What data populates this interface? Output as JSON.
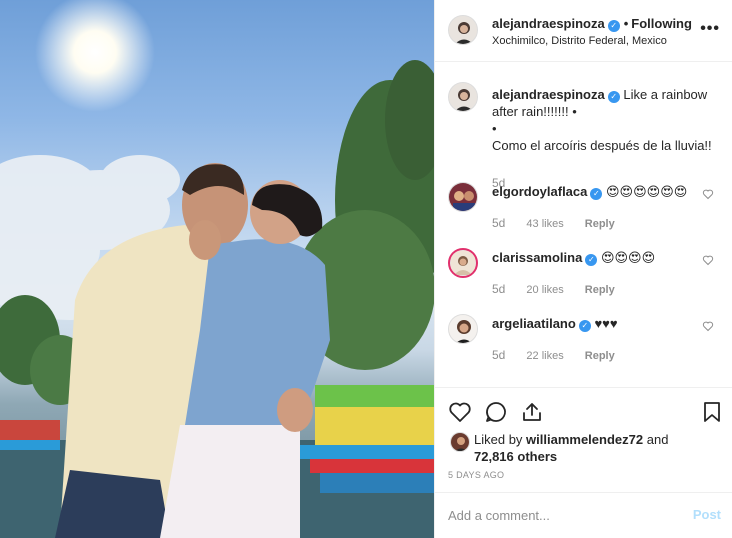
{
  "post": {
    "username": "alejandraespinoza",
    "verified_mark": "✓",
    "separator": "•",
    "follow_status": "Following",
    "location": "Xochimilco, Distrito Federal, Mexico",
    "more_icon": "•••",
    "caption": {
      "username": "alejandraespinoza",
      "text": "Like a rainbow after rain!!!!!!! •",
      "line2": "•",
      "line3": "Como el arcoíris después de la lluvia!!",
      "time": "5d"
    },
    "comments": [
      {
        "username": "elgordoylaflaca",
        "verified": true,
        "text": "😍😍😍😍😍😍",
        "time": "5d",
        "likes": "43 likes",
        "reply": "Reply"
      },
      {
        "username": "clarissamolina",
        "verified": true,
        "text": "😍😍😍😍",
        "time": "5d",
        "likes": "20 likes",
        "reply": "Reply"
      },
      {
        "username": "argeliaatilano",
        "verified": true,
        "text": "♥♥♥",
        "time": "5d",
        "likes": "22 likes",
        "reply": "Reply"
      }
    ],
    "liked_by_prefix": "Liked by",
    "liked_by_user": "williammelendez72",
    "liked_by_and": "and",
    "liked_by_others": "72,816 others",
    "date": "5 DAYS AGO",
    "add_comment_placeholder": "Add a comment...",
    "post_button": "Post"
  },
  "icons": [
    "heart-icon",
    "comment-icon",
    "share-icon",
    "bookmark-icon"
  ],
  "colors": {
    "verified": "#3897f0",
    "muted": "#8e8e8e",
    "post_disabled": "#b2dffc",
    "story_ring": "#e1306c"
  }
}
